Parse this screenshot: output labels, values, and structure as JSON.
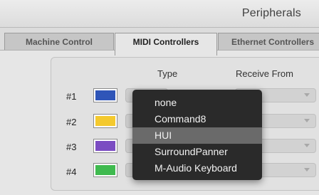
{
  "window": {
    "title": "Peripherals"
  },
  "tabs": [
    {
      "label": "Machine Control",
      "active": false
    },
    {
      "label": "MIDI Controllers",
      "active": true
    },
    {
      "label": "Ethernet Controllers",
      "active": false
    }
  ],
  "table": {
    "columns": {
      "type": "Type",
      "receive_from": "Receive From"
    },
    "rows": [
      {
        "label": "#1",
        "color": "#2f55b8"
      },
      {
        "label": "#2",
        "color": "#f4c92e"
      },
      {
        "label": "#3",
        "color": "#7b4cc2"
      },
      {
        "label": "#4",
        "color": "#3fba4f"
      }
    ]
  },
  "type_menu": {
    "items": [
      "none",
      "Command8",
      "HUI",
      "SurroundPanner",
      "M-Audio Keyboard"
    ],
    "selected": "HUI",
    "background": "#2a2a2a",
    "highlight": "#6a6a6a"
  }
}
